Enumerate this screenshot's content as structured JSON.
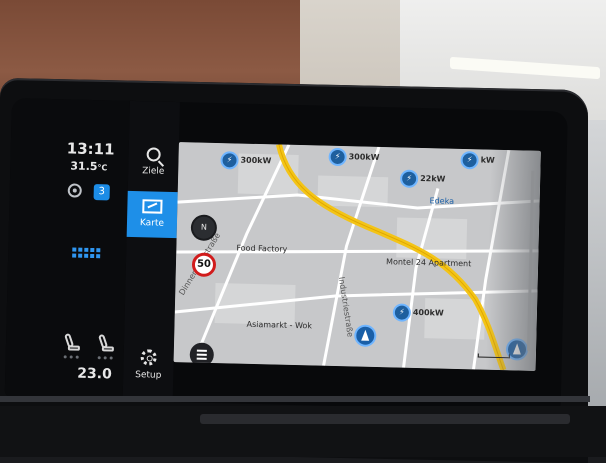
{
  "status": {
    "time": "13:11",
    "outside_temp": "31.5",
    "temp_unit": "°C",
    "profile_badge": "3",
    "climate_temp": "23.0"
  },
  "menu": {
    "items": [
      {
        "label": "Ziele",
        "icon": "search-icon"
      },
      {
        "label": "Karte",
        "icon": "map-icon",
        "active": true
      },
      {
        "label": "Setup",
        "icon": "gear-icon"
      }
    ]
  },
  "map": {
    "speed_limit": "50",
    "compass": "N",
    "labels": {
      "charger1": "300kW",
      "charger2": "300kW",
      "charger3": "22kW",
      "charger4": "kW",
      "charger5": "400kW",
      "edeka": "Edeka",
      "food_factory": "Food Factory",
      "montel": "Montel 24 Apartment",
      "wok": "Asiamarkt - Wok",
      "street1": "Dinnendahlstraße",
      "street2": "Industriestraße"
    },
    "route_color": "#f3c417",
    "accent_color": "#1e8fe8"
  }
}
